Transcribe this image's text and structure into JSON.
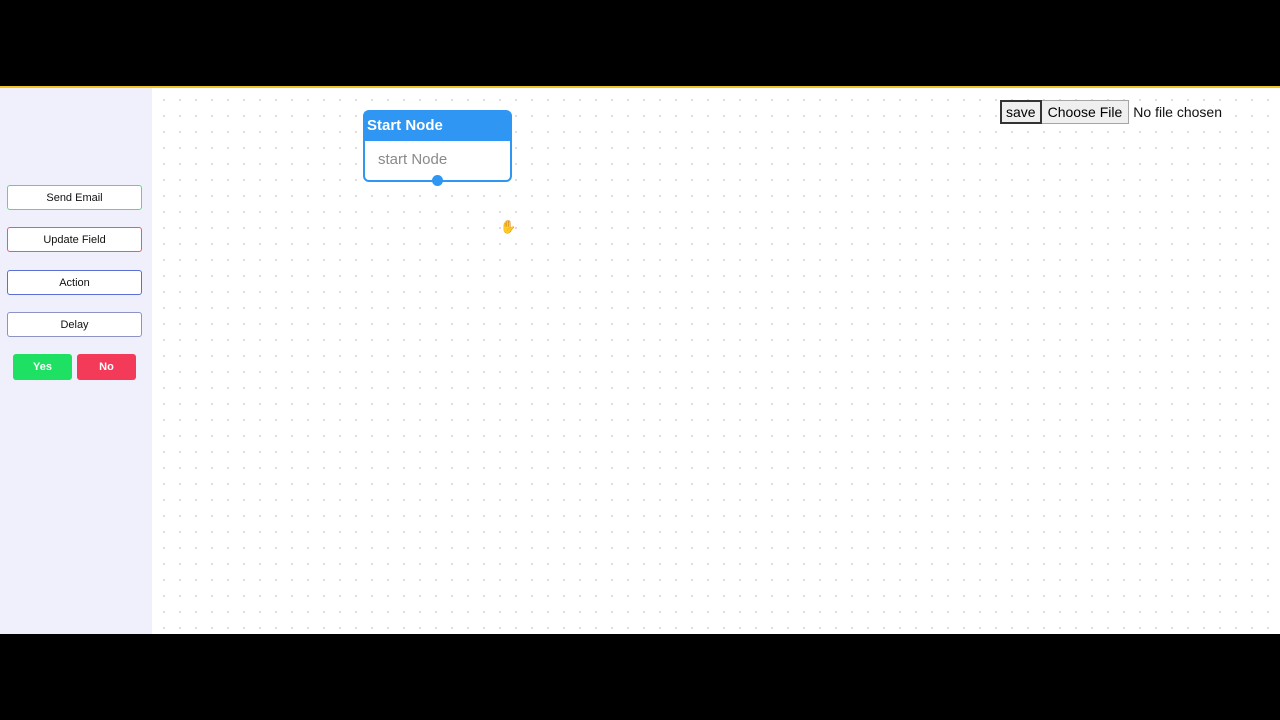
{
  "sidebar": {
    "buttons": [
      {
        "label": "Send Email",
        "accent": "#4fe07a"
      },
      {
        "label": "Update Field",
        "accent": "#f0566f"
      },
      {
        "label": "Action",
        "accent": "#5b6fd6"
      },
      {
        "label": "Delay",
        "accent": "#8d93c4"
      }
    ],
    "yes_label": "Yes",
    "no_label": "No",
    "yes_color": "#1ee063",
    "no_color": "#f43a59"
  },
  "canvas": {
    "node": {
      "title": "Start Node",
      "placeholder": "start Node",
      "color": "#2f96f3"
    },
    "cursor_icon": "hand-grab-icon"
  },
  "toolbar": {
    "save_label": "save",
    "choose_file_label": "Choose File",
    "file_status": "No file chosen"
  }
}
